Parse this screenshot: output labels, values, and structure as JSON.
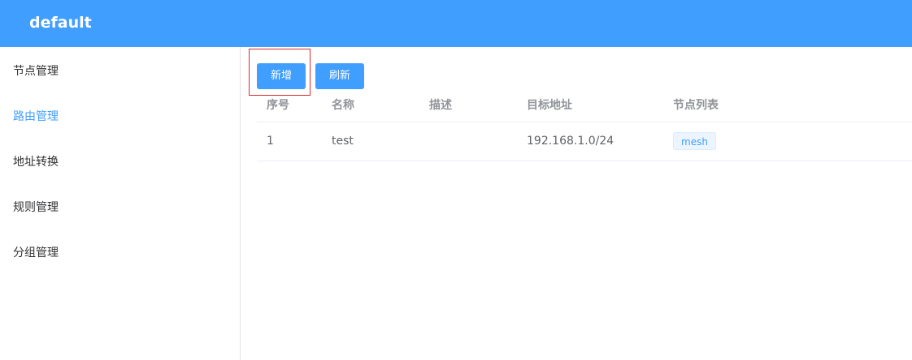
{
  "header": {
    "title": "default"
  },
  "sidebar": {
    "items": [
      {
        "label": "节点管理"
      },
      {
        "label": "路由管理"
      },
      {
        "label": "地址转换"
      },
      {
        "label": "规则管理"
      },
      {
        "label": "分组管理"
      }
    ],
    "active_item": "路由管理"
  },
  "toolbar": {
    "add_label": "新增",
    "refresh_label": "刷新"
  },
  "table": {
    "columns": [
      "序号",
      "名称",
      "描述",
      "目标地址",
      "节点列表"
    ],
    "rows": [
      {
        "index": "1",
        "name": "test",
        "description": "",
        "target": "192.168.1.0/24",
        "nodes": [
          "mesh"
        ]
      }
    ]
  },
  "colors": {
    "primary": "#409eff",
    "highlight": "#d62d2d"
  }
}
